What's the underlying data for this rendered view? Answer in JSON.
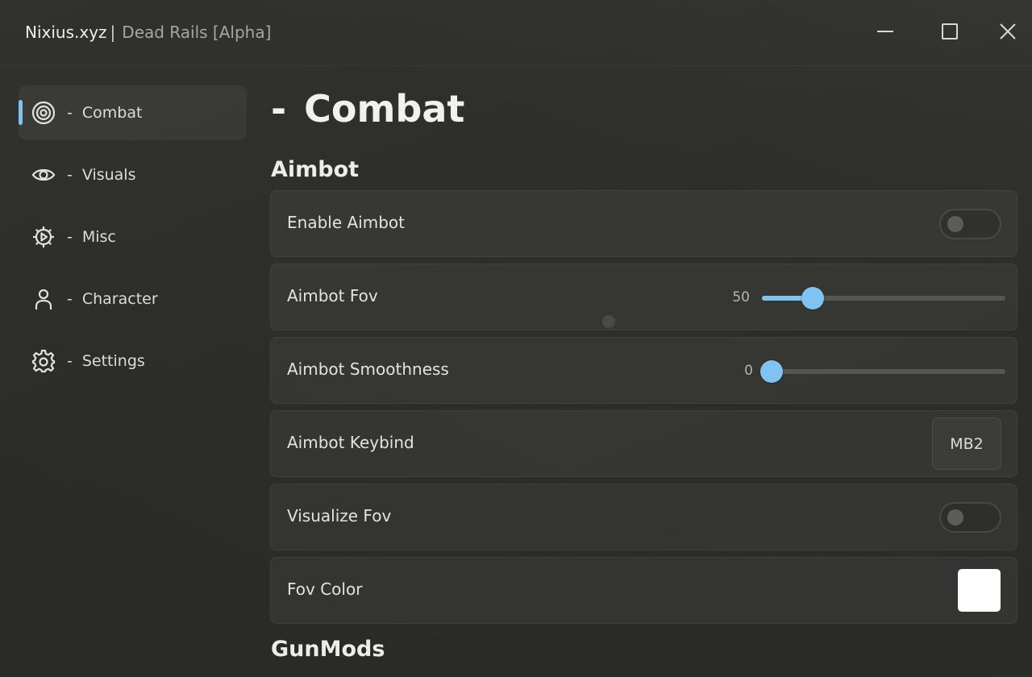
{
  "window": {
    "brand": "Nixius.xyz",
    "separator": "|",
    "subtitle": "Dead Rails [Alpha]"
  },
  "controls": {
    "minimize_icon": "minimize-icon",
    "maximize_icon": "maximize-icon",
    "close_icon": "close-icon"
  },
  "sidebar": {
    "items": [
      {
        "dash": "-",
        "label": "Combat",
        "icon": "target-icon",
        "active": true
      },
      {
        "dash": "-",
        "label": "Visuals",
        "icon": "eye-icon",
        "active": false
      },
      {
        "dash": "-",
        "label": "Misc",
        "icon": "gear-cog-icon",
        "active": false
      },
      {
        "dash": "-",
        "label": "Character",
        "icon": "user-icon",
        "active": false
      },
      {
        "dash": "-",
        "label": "Settings",
        "icon": "settings-icon",
        "active": false
      }
    ]
  },
  "main": {
    "title_dash": "-",
    "title": "Combat",
    "sections": {
      "aimbot": "Aimbot",
      "gunmods": "GunMods"
    },
    "rows": {
      "enable_aimbot": {
        "label": "Enable Aimbot",
        "enabled": false
      },
      "aimbot_fov": {
        "label": "Aimbot Fov",
        "value": "50",
        "fraction": 0.17
      },
      "aimbot_smoothness": {
        "label": "Aimbot Smoothness",
        "value": "0",
        "fraction": 0.0
      },
      "aimbot_keybind": {
        "label": "Aimbot Keybind",
        "key": "MB2"
      },
      "visualize_fov": {
        "label": "Visualize Fov",
        "enabled": false
      },
      "fov_color": {
        "label": "Fov Color",
        "color": "#ffffff"
      }
    }
  },
  "colors": {
    "accent": "#7fc3f2",
    "background": "#2d2d2a"
  }
}
